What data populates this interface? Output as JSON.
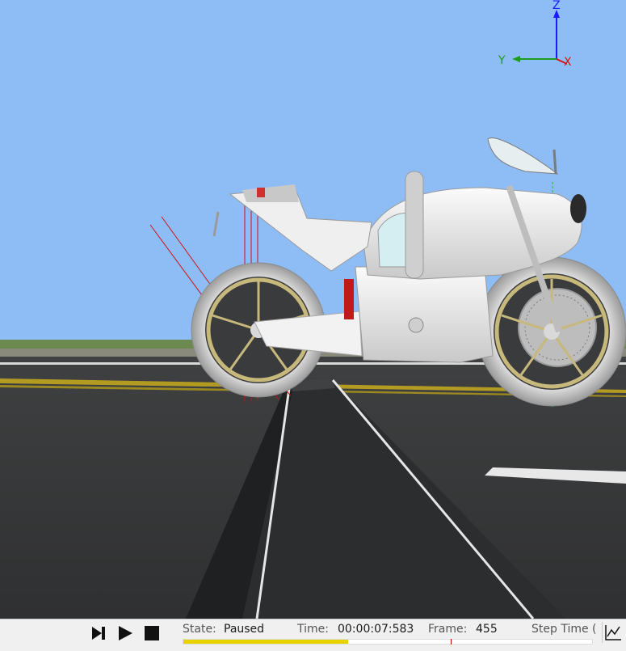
{
  "window": {
    "title": ""
  },
  "colors": {
    "sky": "#8ebdf6",
    "road": "#3a3b3c",
    "grass": "#6c8a50",
    "bike": "#e6e6e6",
    "progress_fill": "#e8d200",
    "axis_x": "#e01010",
    "axis_y": "#1c9c1c",
    "axis_z": "#1a1aff"
  },
  "viewport": {
    "axes": {
      "x_label": "X",
      "y_label": "Y",
      "z_label": "Z"
    },
    "icons": [
      "axis-triad-icon",
      "motorcycle-model",
      "road-ramp"
    ]
  },
  "toolbar": {
    "buttons": [
      {
        "name": "step",
        "icon": "step-forward-icon"
      },
      {
        "name": "play",
        "icon": "play-icon"
      },
      {
        "name": "stop",
        "icon": "stop-icon"
      }
    ],
    "state_label": "State:",
    "state_value": "Paused",
    "time_label": "Time:",
    "time_value": "00:00:07:583",
    "frame_label": "Frame:",
    "frame_value": "455",
    "step_time_label": "Step Time (",
    "progress_fraction": 0.404,
    "marker_fraction": 0.655,
    "chart_icon": "line-chart-icon"
  }
}
